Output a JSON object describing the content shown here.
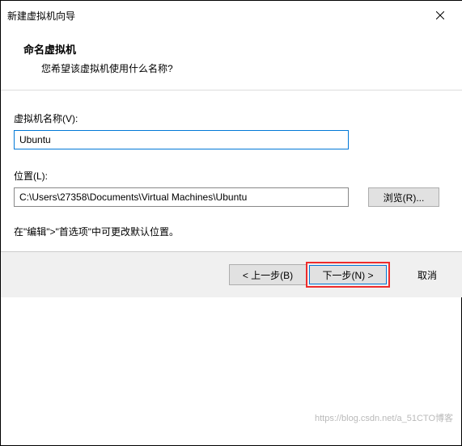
{
  "titlebar": {
    "title": "新建虚拟机向导"
  },
  "header": {
    "title": "命名虚拟机",
    "subtitle": "您希望该虚拟机使用什么名称?"
  },
  "form": {
    "name_label": "虚拟机名称(V):",
    "name_value": "Ubuntu",
    "location_label": "位置(L):",
    "location_value": "C:\\Users\\27358\\Documents\\Virtual Machines\\Ubuntu",
    "browse_label": "浏览(R)...",
    "hint": "在\"编辑\">\"首选项\"中可更改默认位置。"
  },
  "footer": {
    "back_label": "< 上一步(B)",
    "next_label": "下一步(N) >",
    "cancel_label": "取消"
  },
  "watermark": "https://blog.csdn.net/a_51CTO博客"
}
